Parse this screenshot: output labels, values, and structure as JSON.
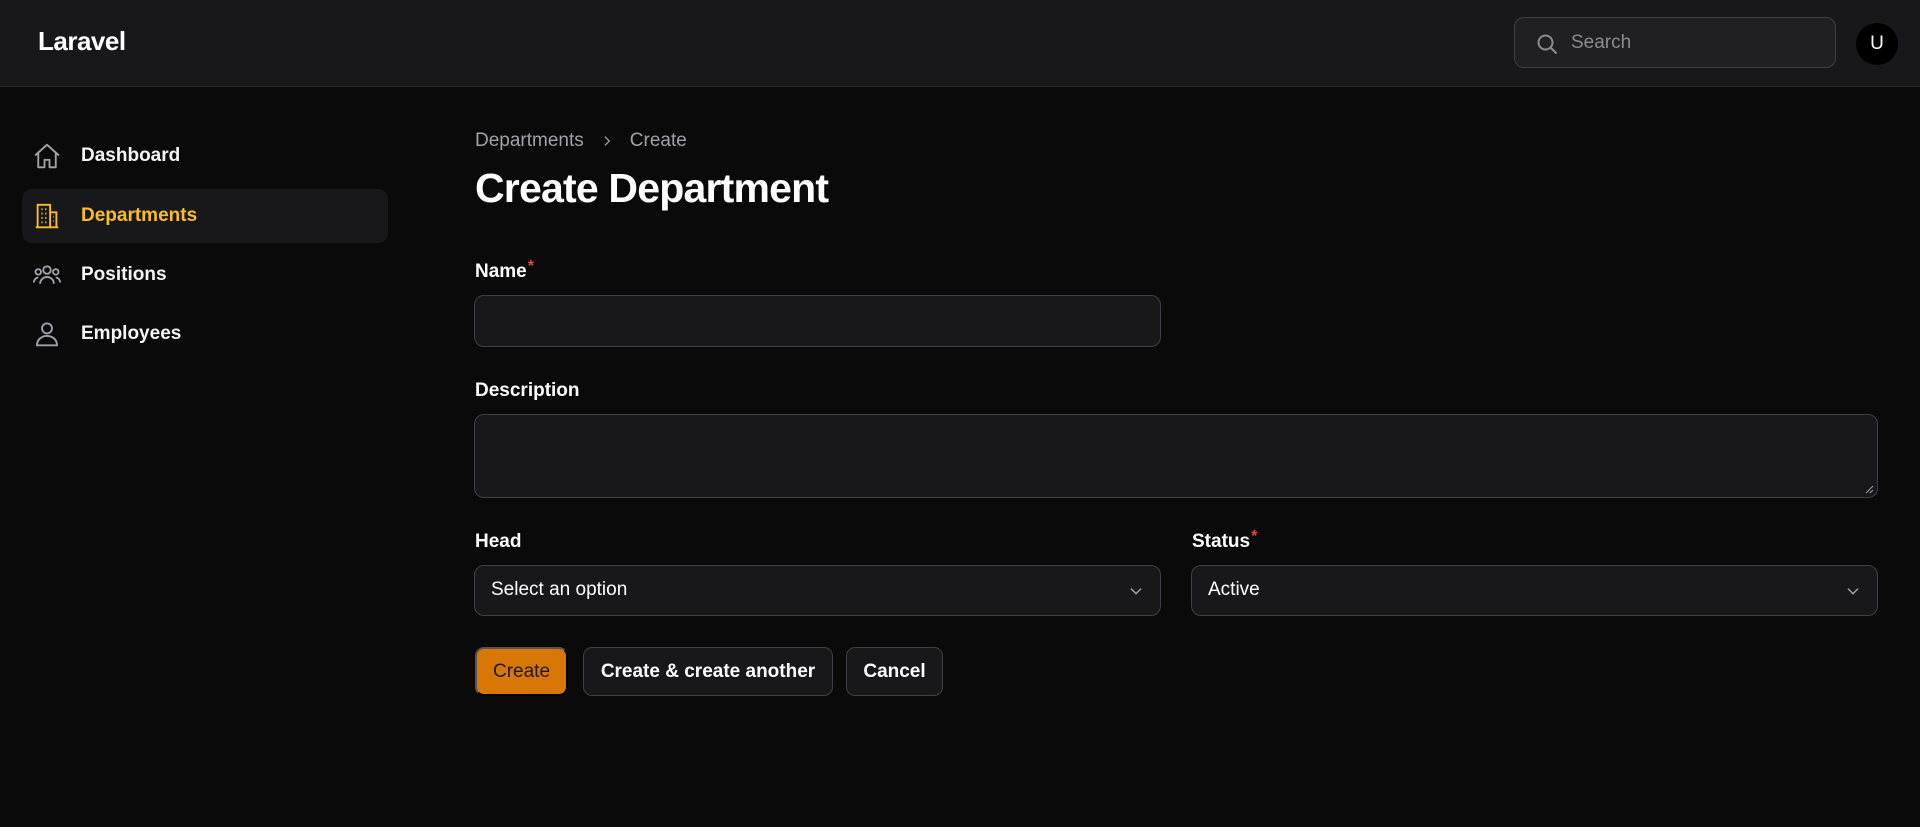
{
  "app": {
    "brand": "Laravel"
  },
  "header": {
    "search_placeholder": "Search",
    "avatar_initial": "U"
  },
  "sidebar": {
    "items": [
      {
        "label": "Dashboard",
        "icon": "home-icon",
        "active": false
      },
      {
        "label": "Departments",
        "icon": "building-icon",
        "active": true
      },
      {
        "label": "Positions",
        "icon": "user-group-icon",
        "active": false
      },
      {
        "label": "Employees",
        "icon": "user-icon",
        "active": false
      }
    ]
  },
  "breadcrumb": {
    "parent": "Departments",
    "current": "Create"
  },
  "page": {
    "title": "Create Department"
  },
  "form": {
    "name": {
      "label": "Name",
      "required_mark": "*",
      "value": ""
    },
    "description": {
      "label": "Description",
      "value": ""
    },
    "head": {
      "label": "Head",
      "value": "Select an option"
    },
    "status": {
      "label": "Status",
      "required_mark": "*",
      "value": "Active"
    }
  },
  "actions": {
    "create": "Create",
    "create_another": "Create & create another",
    "cancel": "Cancel"
  },
  "colors": {
    "accent": "#fbbf24",
    "primary_button": "#d97706",
    "required": "#ef4444"
  }
}
